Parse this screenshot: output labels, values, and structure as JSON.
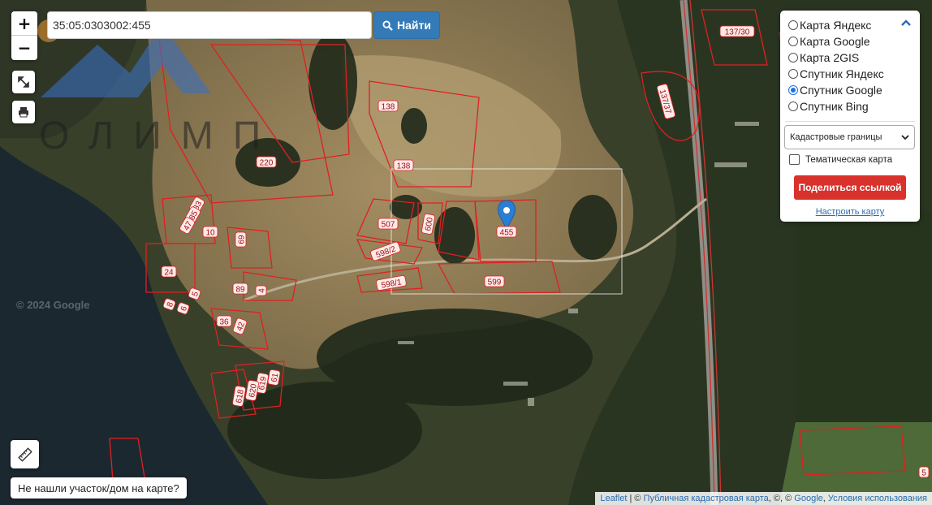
{
  "search": {
    "value": "35:05:0303002:455",
    "button_label": "Найти"
  },
  "zoom": {
    "in_label": "+",
    "out_label": "−"
  },
  "layers": [
    {
      "label": "Карта Яндекс",
      "selected": false
    },
    {
      "label": "Карта Google",
      "selected": false
    },
    {
      "label": "Карта 2GIS",
      "selected": false
    },
    {
      "label": "Спутник Яндекс",
      "selected": false
    },
    {
      "label": "Спутник Google",
      "selected": true
    },
    {
      "label": "Спутник Bing",
      "selected": false
    }
  ],
  "overlay_select": {
    "value": "Кадастровые границы"
  },
  "thematic_map": {
    "label": "Тематическая карта",
    "checked": false
  },
  "share_button": "Поделиться ссылкой",
  "setup_link": "Настроить карту",
  "not_found_button": "Не нашли участок/дом на карте?",
  "attribution": {
    "leaflet": "Leaflet",
    "sep1": " | © ",
    "cadastral": "Публичная кадастровая карта",
    "sep2": ", ©, © ",
    "google": "Google",
    "sep3": ", ",
    "terms": "Условия использования"
  },
  "watermark": "© 2024 Google",
  "logo_text": "ОЛИМП",
  "parcel_labels": [
    "137/30",
    "137/37",
    "138",
    "138",
    "220",
    "83",
    "85",
    "47",
    "10",
    "69",
    "24",
    "89",
    "4",
    "5",
    "6",
    "8",
    "36",
    "42",
    "61",
    "619",
    "620",
    "618",
    "507",
    "600",
    "598/2",
    "598/1",
    "455",
    "599",
    "5"
  ],
  "colors": {
    "parcel": "#e02020",
    "marker": "#2a7fd4",
    "accent": "#337ab7",
    "share": "#d9312b"
  }
}
